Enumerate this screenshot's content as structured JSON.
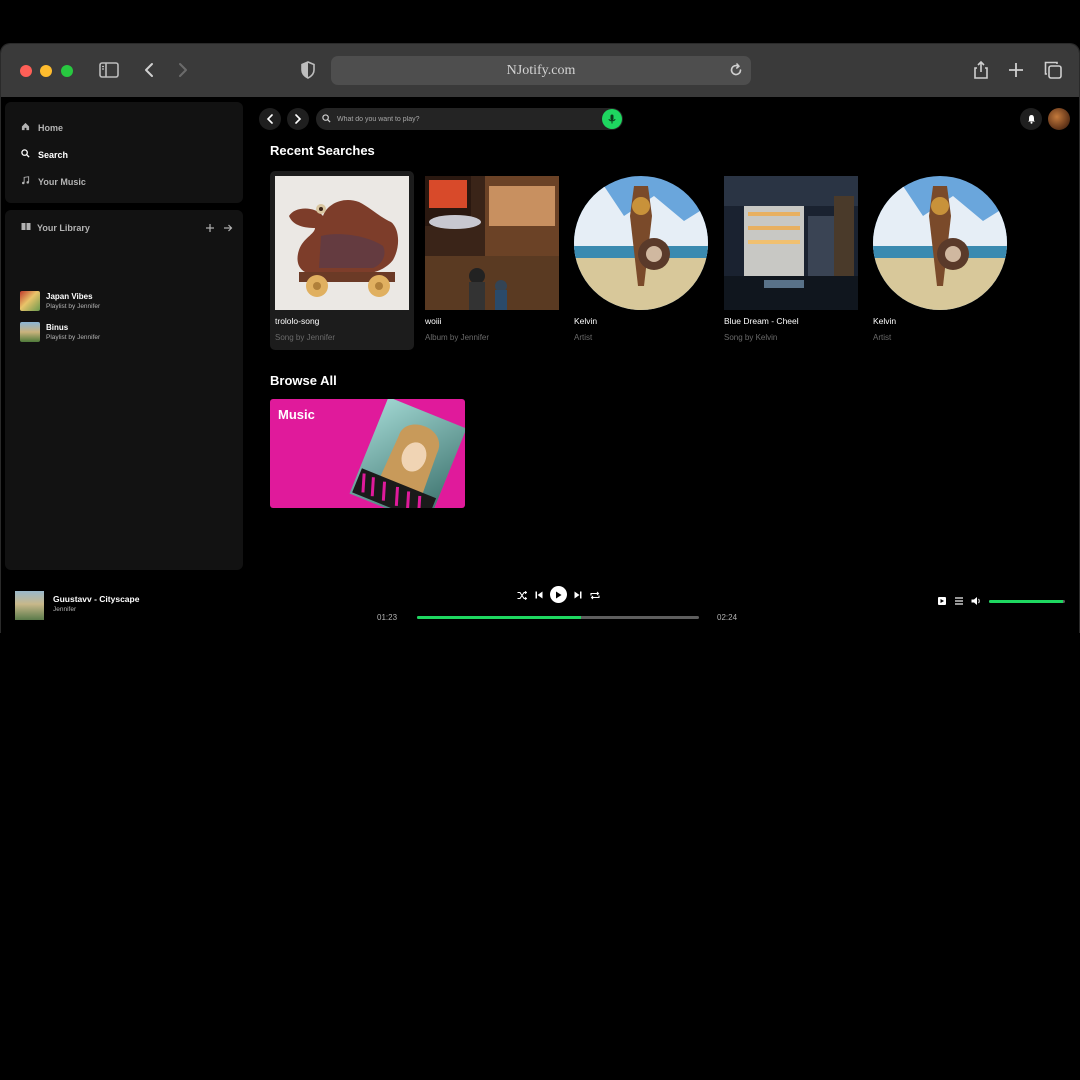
{
  "browser": {
    "url": "NJotify.com"
  },
  "sidebar": {
    "nav": [
      {
        "label": "Home",
        "icon": "home-icon"
      },
      {
        "label": "Search",
        "icon": "search-icon",
        "active": true
      },
      {
        "label": "Your Music",
        "icon": "music-note-icon"
      }
    ],
    "library": {
      "title": "Your Library",
      "items": [
        {
          "title": "Japan Vibes",
          "subtitle": "Playlist by Jennifer"
        },
        {
          "title": "Binus",
          "subtitle": "Playlist by Jennifer"
        }
      ]
    }
  },
  "header": {
    "search_placeholder": "What do you want to play?"
  },
  "recent": {
    "title": "Recent Searches",
    "items": [
      {
        "title": "trololo-song",
        "subtitle": "Song by Jennifer",
        "shape": "square"
      },
      {
        "title": "woiii",
        "subtitle": "Album by Jennifer",
        "shape": "square"
      },
      {
        "title": "Kelvin",
        "subtitle": "Artist",
        "shape": "round"
      },
      {
        "title": "Blue Dream - Cheel",
        "subtitle": "Song by Kelvin",
        "shape": "square"
      },
      {
        "title": "Kelvin",
        "subtitle": "Artist",
        "shape": "round"
      }
    ]
  },
  "browse": {
    "title": "Browse All",
    "tiles": [
      {
        "label": "Music",
        "color": "#e01a9b"
      }
    ]
  },
  "player": {
    "track_title": "Guustavv - Cityscape",
    "artist": "Jennifer",
    "elapsed": "01:23",
    "duration": "02:24",
    "progress": 0.58,
    "volume": 0.98
  },
  "colors": {
    "accent": "#1ed760",
    "background": "#000000",
    "panel": "#121212"
  }
}
